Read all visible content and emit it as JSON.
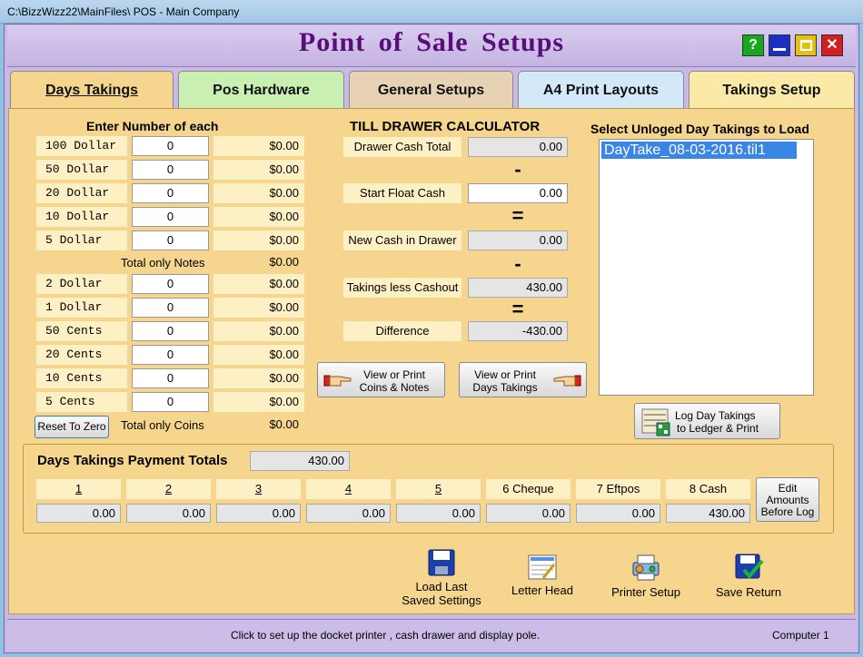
{
  "window": {
    "title": "C:\\BizzWizz22\\MainFiles\\ POS - Main Company",
    "heading": "Point of Sale Setups"
  },
  "tabs": [
    {
      "label": "Days Takings",
      "active": true
    },
    {
      "label": "Pos Hardware"
    },
    {
      "label": "General Setups"
    },
    {
      "label": "A4 Print Layouts"
    },
    {
      "label": "Takings Setup"
    }
  ],
  "counter": {
    "header": "Enter Number of each",
    "notes": [
      {
        "denom": "100 Dollar",
        "count": "0",
        "amount": "$0.00"
      },
      {
        "denom": "50 Dollar",
        "count": "0",
        "amount": "$0.00"
      },
      {
        "denom": "20 Dollar",
        "count": "0",
        "amount": "$0.00"
      },
      {
        "denom": "10 Dollar",
        "count": "0",
        "amount": "$0.00"
      },
      {
        "denom": "5 Dollar",
        "count": "0",
        "amount": "$0.00"
      }
    ],
    "notes_total_label": "Total only Notes",
    "notes_total": "$0.00",
    "coins": [
      {
        "denom": "2 Dollar",
        "count": "0",
        "amount": "$0.00"
      },
      {
        "denom": "1 Dollar",
        "count": "0",
        "amount": "$0.00"
      },
      {
        "denom": "50 Cents",
        "count": "0",
        "amount": "$0.00"
      },
      {
        "denom": "20 Cents",
        "count": "0",
        "amount": "$0.00"
      },
      {
        "denom": "10 Cents",
        "count": "0",
        "amount": "$0.00"
      },
      {
        "denom": "5 Cents",
        "count": "0",
        "amount": "$0.00"
      }
    ],
    "reset_label": "Reset To Zero",
    "coins_total_label": "Total only Coins",
    "coins_total": "$0.00"
  },
  "calculator": {
    "header": "TILL DRAWER CALCULATOR",
    "drawer_label": "Drawer Cash Total",
    "drawer_value": "0.00",
    "minus1": "-",
    "float_label": "Start Float Cash",
    "float_value": "0.00",
    "eq1": "=",
    "new_cash_label": "New Cash in Drawer",
    "new_cash_value": "0.00",
    "minus2": "-",
    "takings_label": "Takings less Cashout",
    "takings_value": "430.00",
    "eq2": "=",
    "diff_label": "Difference",
    "diff_value": "-430.00",
    "view_coins_line1": "View or Print",
    "view_coins_line2": "Coins & Notes",
    "view_days_line1": "View or Print",
    "view_days_line2": "Days Takings"
  },
  "unlogged": {
    "header": "Select Unloged Day Takings to Load",
    "items": [
      "DayTake_08-03-2016.til1"
    ],
    "log_line1": "Log Day Takings",
    "log_line2": "to Ledger & Print"
  },
  "payments": {
    "header": "Days Takings Payment Totals",
    "total": "430.00",
    "columns": [
      {
        "label": "1",
        "value": "0.00",
        "underline": true
      },
      {
        "label": "2",
        "value": "0.00",
        "underline": true
      },
      {
        "label": "3",
        "value": "0.00",
        "underline": true
      },
      {
        "label": "4",
        "value": "0.00",
        "underline": true
      },
      {
        "label": "5",
        "value": "0.00",
        "underline": true
      },
      {
        "label": "6 Cheque",
        "value": "0.00"
      },
      {
        "label": "7 Eftpos",
        "value": "0.00"
      },
      {
        "label": "8 Cash",
        "value": "430.00"
      }
    ],
    "edit_line1": "Edit",
    "edit_line2": "Amounts",
    "edit_line3": "Before Log"
  },
  "toolbar": {
    "load_line1": "Load Last",
    "load_line2": "Saved Settings",
    "letter_head": "Letter Head",
    "printer_setup": "Printer Setup",
    "save_return": "Save Return"
  },
  "status": {
    "message": "Click to set up the docket printer , cash drawer and display pole.",
    "computer": "Computer 1"
  }
}
